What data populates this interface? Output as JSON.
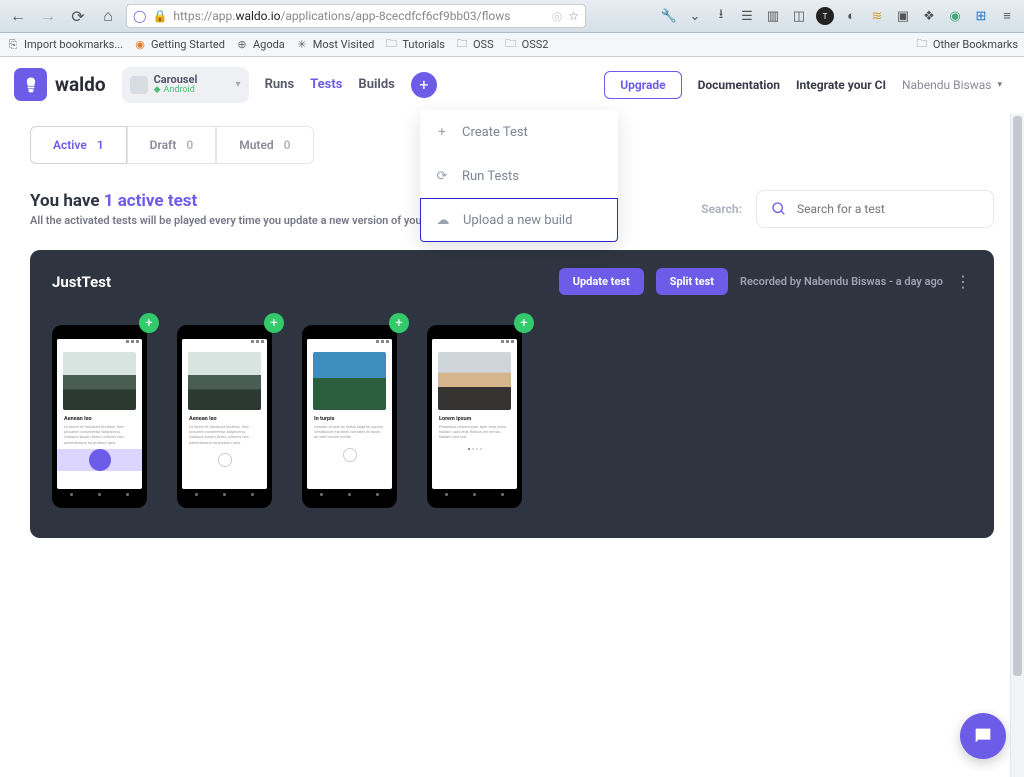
{
  "browser": {
    "url_host": "https://app.",
    "url_bold": "waldo.io",
    "url_path": "/applications/app-8cecdfcf6cf9bb03/flows",
    "bookmarks": [
      "Import bookmarks...",
      "Getting Started",
      "Agoda",
      "Most Visited",
      "Tutorials",
      "OSS",
      "OSS2"
    ],
    "other_bookmarks": "Other Bookmarks"
  },
  "header": {
    "logo": "waldo",
    "app_selector": {
      "name": "Carousel",
      "platform": "Android"
    },
    "nav": [
      "Runs",
      "Tests",
      "Builds"
    ],
    "upgrade": "Upgrade",
    "links": [
      "Documentation",
      "Integrate your CI"
    ],
    "user": "Nabendu Biswas"
  },
  "dropdown": [
    "Create Test",
    "Run Tests",
    "Upload a new build"
  ],
  "tabs": [
    {
      "label": "Active",
      "count": "1"
    },
    {
      "label": "Draft",
      "count": "0"
    },
    {
      "label": "Muted",
      "count": "0"
    }
  ],
  "title": {
    "prefix": "You have ",
    "highlight": "1 active test",
    "sub": "All the activated tests will be played every time you update a new version of your app."
  },
  "search": {
    "label": "Search:",
    "placeholder": "Search for a test"
  },
  "test": {
    "name": "JustTest",
    "update": "Update test",
    "split": "Split test",
    "recorded": "Recorded by Nabendu Biswas - a day ago",
    "steps": [
      {
        "heading": "Aenean leo",
        "body": "Ut lorem et tincidunt facilisis. Sed posuere consectetur adipiscing. Quisque ipsum libero, ultrices nec, pellentesque eu pretium quis.",
        "variant": "mountain",
        "pager": "solid"
      },
      {
        "heading": "Aenean leo",
        "body": "Ut lorem et tincidunt facilisis. Sed posuere consectetur adipiscing. Quisque ipsum libero, ultrices nec, pellentesque eu pretium quis.",
        "variant": "mountain",
        "pager": "ring"
      },
      {
        "heading": "In turpis",
        "body": "Aenean ut erat ac tellus sagittis cursus. Vestibulum facilisis convallis at lacus ac velit ornare mollis.",
        "variant": "trees",
        "pager": "ring"
      },
      {
        "heading": "Lorem ipsum",
        "body": "Phasellus ullamcorper aper eros justo. Nullam quis erat, finibus vel metus. Nullam sed nisl.",
        "variant": "desert",
        "pager": "dots"
      }
    ]
  }
}
